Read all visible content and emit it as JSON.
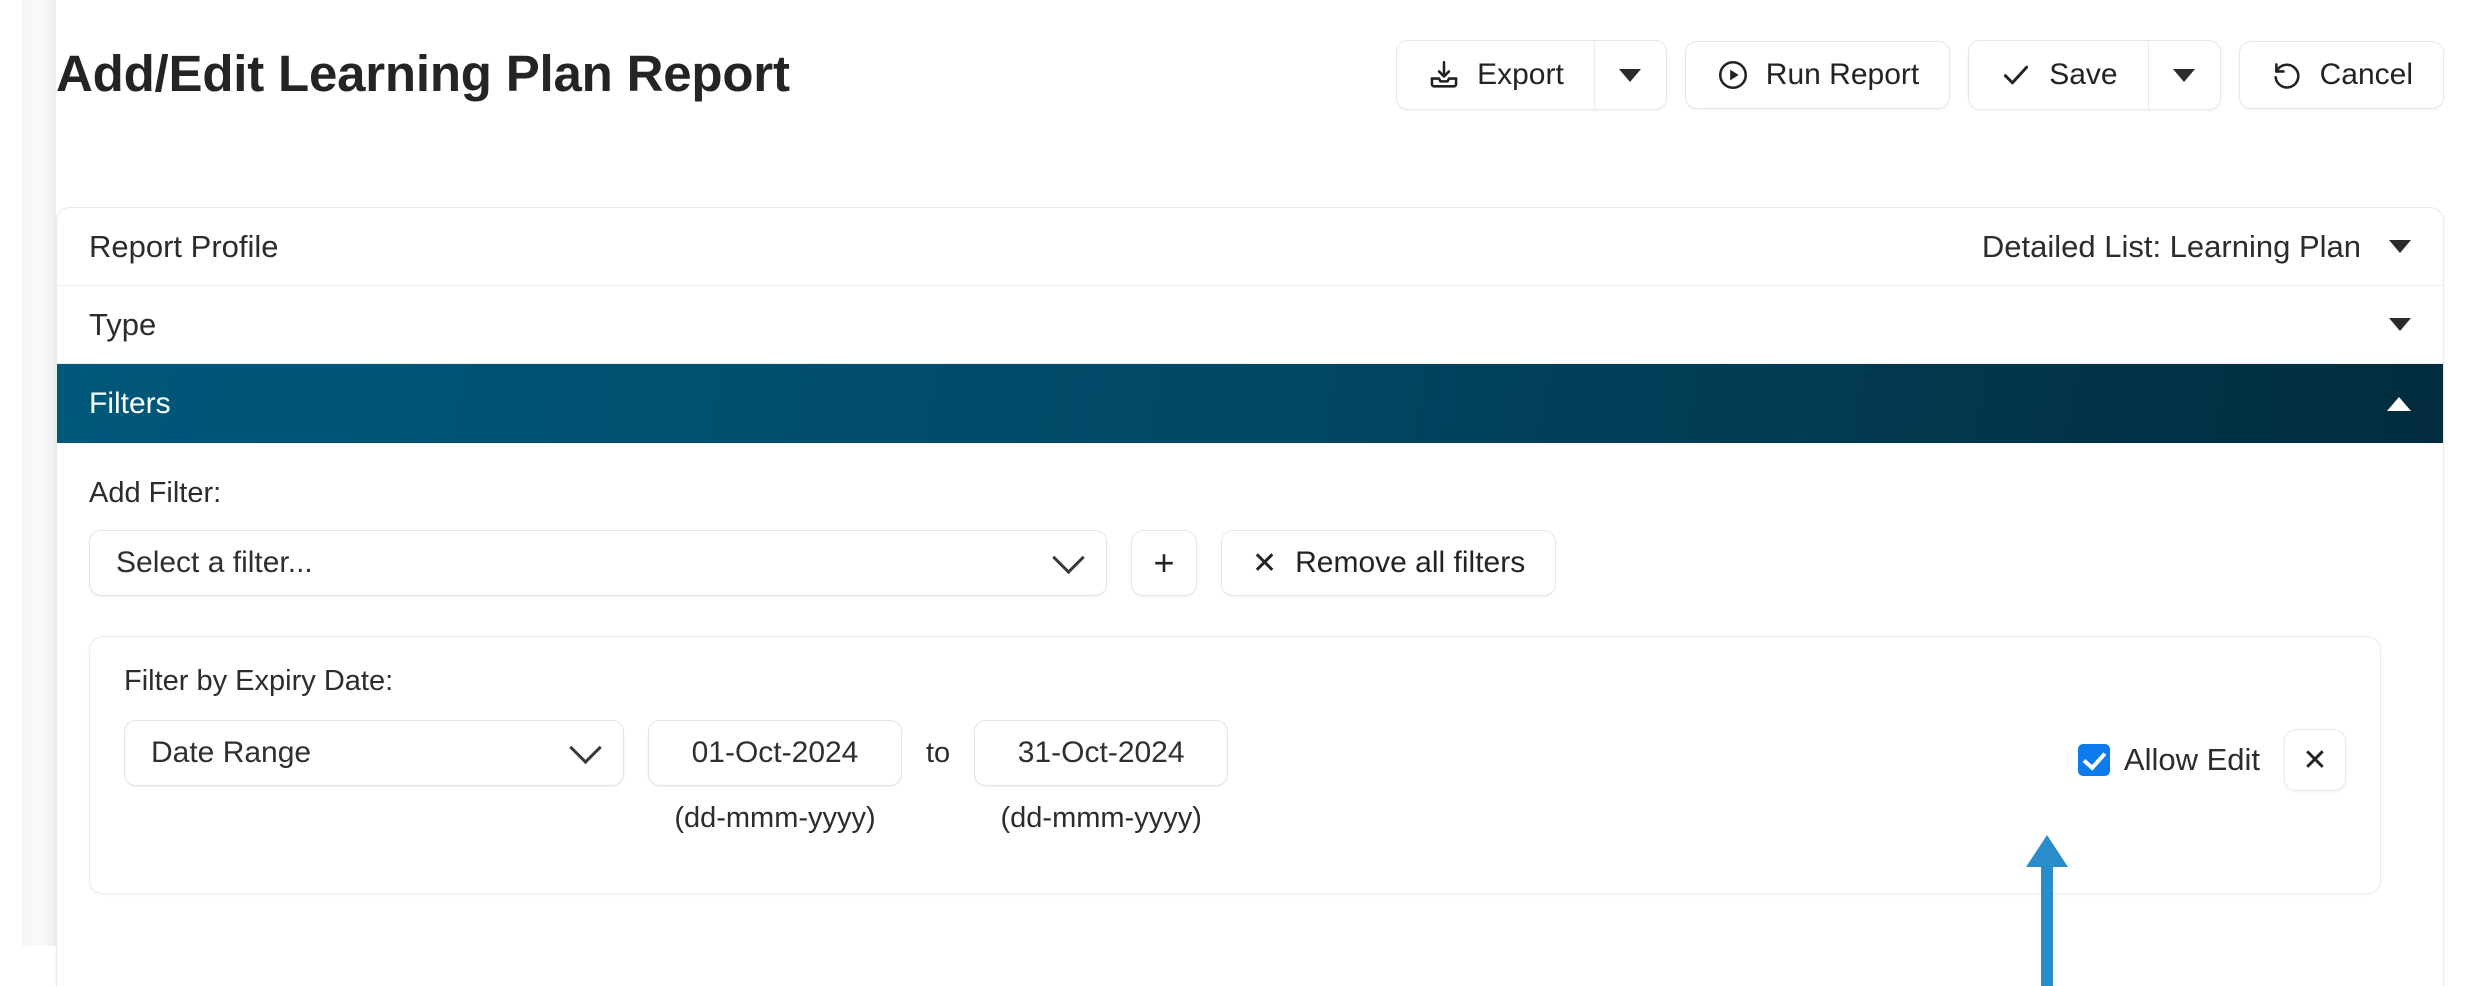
{
  "header": {
    "title": "Add/Edit Learning Plan Report",
    "toolbar": {
      "export_label": "Export",
      "export_icon": "export-download-icon",
      "export_dropdown_icon": "chevron-down-icon",
      "run_report_label": "Run Report",
      "run_report_icon": "play-circle-icon",
      "save_label": "Save",
      "save_icon": "check-icon",
      "save_dropdown_icon": "chevron-down-icon",
      "cancel_label": "Cancel",
      "cancel_icon": "undo-rotate-left-icon"
    }
  },
  "accordion": {
    "report_profile": {
      "label": "Report Profile",
      "value": "Detailed List: Learning Plan",
      "chevron": "chevron-down-icon"
    },
    "type": {
      "label": "Type",
      "value": "",
      "chevron": "chevron-down-icon"
    },
    "filters": {
      "label": "Filters",
      "expanded": true,
      "chevron": "chevron-up-icon",
      "header_gradient_from": "#00587a",
      "header_gradient_to": "#022c3d"
    }
  },
  "filters": {
    "add_filter_label": "Add Filter:",
    "select_filter_value": "Select a filter...",
    "select_filter_placeholder": "Select a filter...",
    "add_button_icon": "plus-icon",
    "add_button_glyph": "+",
    "remove_all_label": "Remove all filters",
    "remove_all_icon": "close-x-icon",
    "remove_all_glyph": "✕",
    "filter_card": {
      "title": "Filter by Expiry Date:",
      "mode_value": "Date Range",
      "date_from": "01-Oct-2024",
      "date_to": "31-Oct-2024",
      "separator": "to",
      "date_from_hint": "(dd-mmm-yyyy)",
      "date_to_hint": "(dd-mmm-yyyy)",
      "allow_edit_label": "Allow Edit",
      "allow_edit_checked": true,
      "remove_filter_icon": "close-x-icon",
      "remove_filter_glyph": "✕"
    }
  },
  "annotation": {
    "arrow_icon": "up-arrow-annotation",
    "arrow_color": "#2b8ccc",
    "points_at": "allow-edit-checkbox"
  },
  "colors": {
    "accent_blue": "#0b7bee",
    "panel_header": "#00587a",
    "text": "#2c2c2c"
  }
}
